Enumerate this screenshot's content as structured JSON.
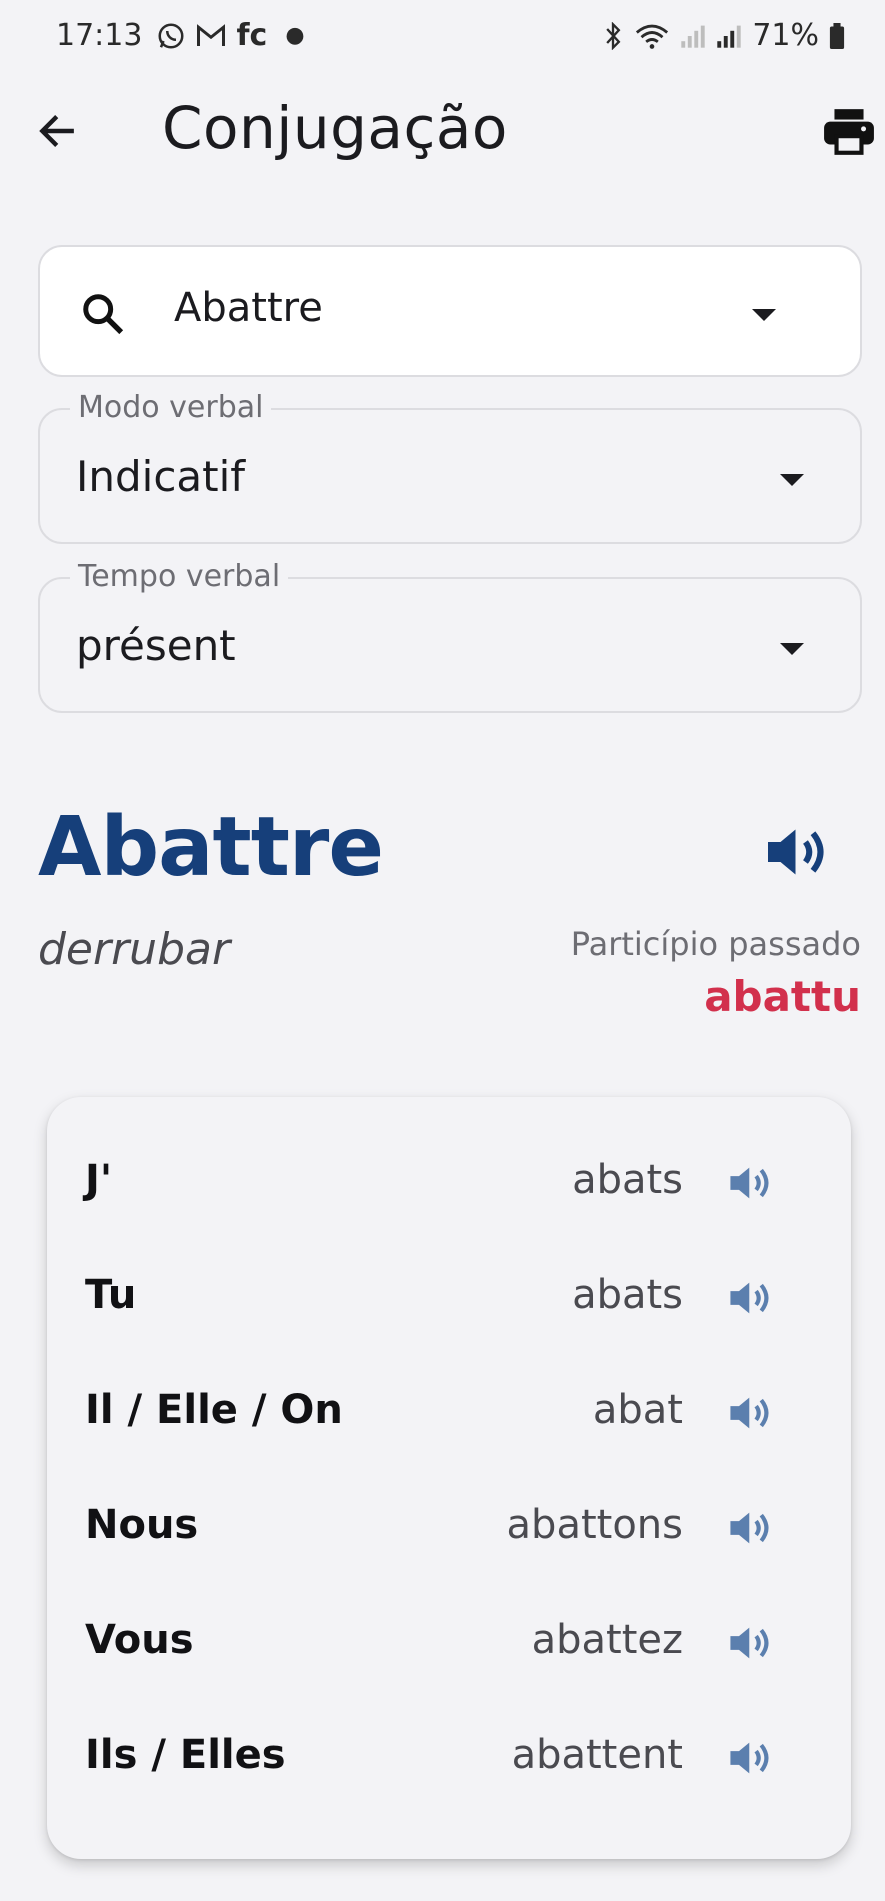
{
  "status_bar": {
    "time": "17:13",
    "notification_label": "fc",
    "battery": "71%",
    "icons": [
      "whatsapp-icon",
      "gmail-icon",
      "bluetooth-icon",
      "wifi-icon",
      "signal-icon",
      "signal-icon",
      "battery-icon"
    ]
  },
  "app_bar": {
    "title": "Conjugação",
    "back_icon": "arrow-left-icon",
    "print_icon": "printer-icon"
  },
  "search": {
    "value": "Abattre",
    "icon": "search-icon"
  },
  "modo_verbal": {
    "label": "Modo verbal",
    "value": "Indicatif"
  },
  "tempo_verbal": {
    "label": "Tempo verbal",
    "value": "présent"
  },
  "verb": {
    "infinitive": "Abattre",
    "translation": "derrubar",
    "past_participle_label": "Particípio passado",
    "past_participle": "abattu"
  },
  "conjugations": [
    {
      "pronoun": "J'",
      "form": "abats"
    },
    {
      "pronoun": "Tu",
      "form": "abats"
    },
    {
      "pronoun": "Il / Elle / On",
      "form": "abat"
    },
    {
      "pronoun": "Nous",
      "form": "abattons"
    },
    {
      "pronoun": "Vous",
      "form": "abattez"
    },
    {
      "pronoun": "Ils / Elles",
      "form": "abattent"
    }
  ],
  "colors": {
    "accent_blue": "#163f7a",
    "participle_red": "#d2304c",
    "speaker_light_blue": "#5b7fae",
    "background": "#f3f3f6"
  }
}
